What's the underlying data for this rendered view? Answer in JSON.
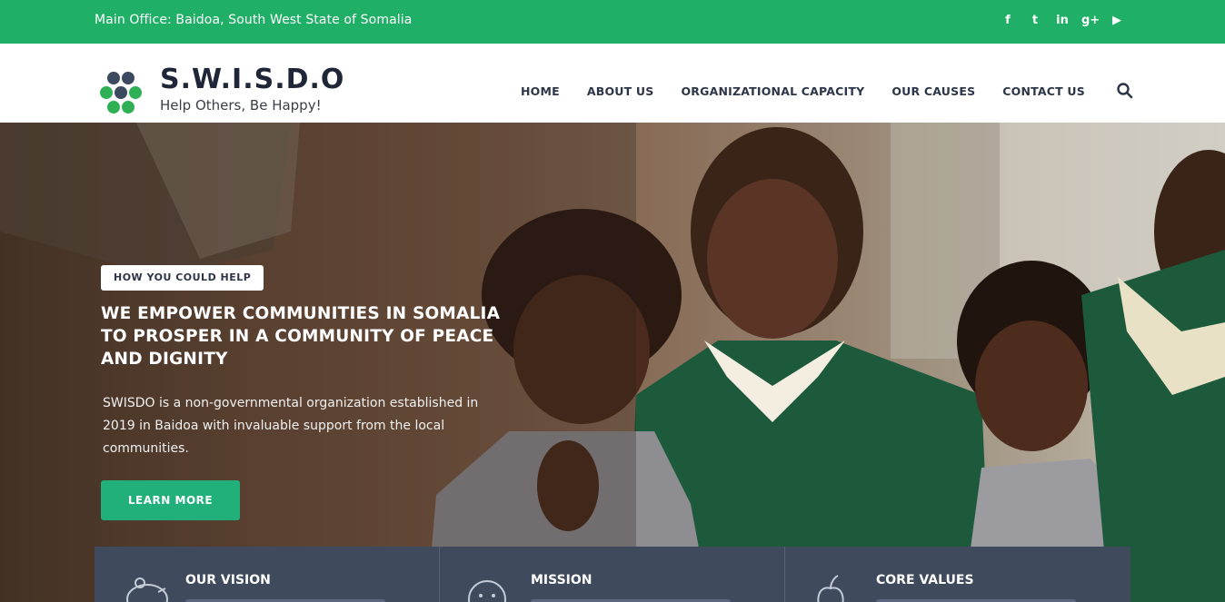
{
  "topbar": {
    "office": "Main Office: Baidoa, South West State of Somalia",
    "social": [
      "f",
      "t",
      "in",
      "g+",
      "▶"
    ]
  },
  "brand": {
    "name": "S.W.I.S.D.O",
    "tagline": "Help Others, Be Happy!"
  },
  "nav": {
    "items": [
      "HOME",
      "ABOUT US",
      "ORGANIZATIONAL CAPACITY",
      "OUR CAUSES",
      "CONTACT US"
    ]
  },
  "hero": {
    "pill": "HOW YOU COULD HELP",
    "title": "WE EMPOWER COMMUNITIES IN SOMALIA TO PROSPER IN A COMMUNITY OF PEACE AND DIGNITY",
    "text": "SWISDO is a non-governmental organization established in 2019 in Baidoa with invaluable support from the local communities.",
    "button": "LEARN MORE"
  },
  "cards": [
    {
      "title": "OUR VISION",
      "icon": "piggy-bank-icon"
    },
    {
      "title": "MISSION",
      "icon": "smiley-icon"
    },
    {
      "title": "CORE VALUES",
      "icon": "apple-icon"
    }
  ],
  "colors": {
    "topbar": "#1faf66",
    "button": "#22b07a",
    "cards": "#3f4a5d",
    "nav_text": "#2d3648"
  }
}
